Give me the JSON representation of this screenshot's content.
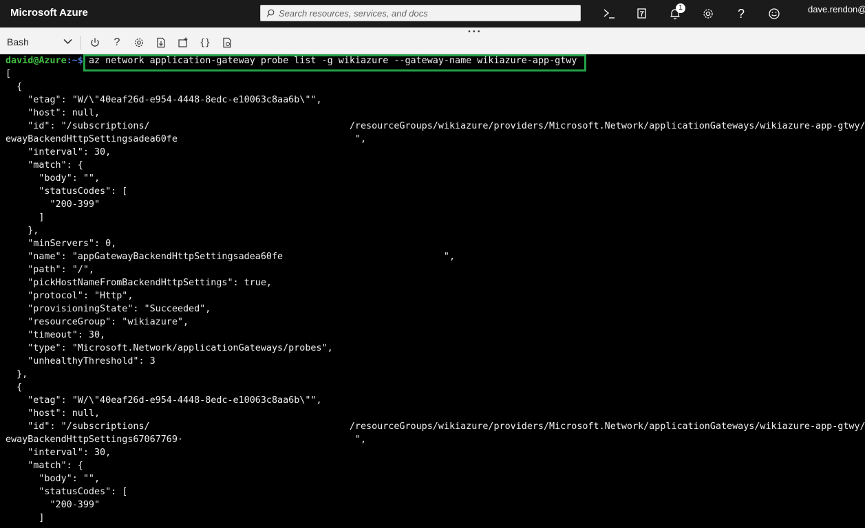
{
  "topbar": {
    "brand": "Microsoft Azure",
    "search_placeholder": "Search resources, services, and docs",
    "notification_count": "1",
    "user": "dave.rendon@",
    "icons": [
      "cloud-shell-icon",
      "directory-filter-icon",
      "bell-icon",
      "gear-icon",
      "help-icon",
      "feedback-smiley-icon"
    ]
  },
  "toolbar": {
    "grip": "•••",
    "shell": "Bash",
    "icons": [
      "power-icon",
      "help-icon",
      "gear-icon",
      "upload-download-icon",
      "new-session-icon",
      "editor-braces-icon",
      "web-preview-icon"
    ]
  },
  "terminal": {
    "prompt_user": "david@Azure",
    "prompt_path": ":~$",
    "command": "az network application-gateway probe list -g wikiazure --gateway-name wikiazure-app-gtwy",
    "highlight_color": "#23a247",
    "output": [
      "[",
      "  {",
      "    \"etag\": \"W/\\\"40eaf26d-e954-4448-8edc-e10063c8aa6b\\\"\",",
      "    \"host\": null,",
      "    \"id\": \"/subscriptions/                                    /resourceGroups/wikiazure/providers/Microsoft.Network/applicationGateways/wikiazure-app-gtwy/p",
      "ewayBackendHttpSettingsadea60fe                                \",",
      "    \"interval\": 30,",
      "    \"match\": {",
      "      \"body\": \"\",",
      "      \"statusCodes\": [",
      "        \"200-399\"",
      "      ]",
      "    },",
      "    \"minServers\": 0,",
      "    \"name\": \"appGatewayBackendHttpSettingsadea60fe                             \",",
      "    \"path\": \"/\",",
      "    \"pickHostNameFromBackendHttpSettings\": true,",
      "    \"protocol\": \"Http\",",
      "    \"provisioningState\": \"Succeeded\",",
      "    \"resourceGroup\": \"wikiazure\",",
      "    \"timeout\": 30,",
      "    \"type\": \"Microsoft.Network/applicationGateways/probes\",",
      "    \"unhealthyThreshold\": 3",
      "  },",
      "  {",
      "    \"etag\": \"W/\\\"40eaf26d-e954-4448-8edc-e10063c8aa6b\\\"\",",
      "    \"host\": null,",
      "    \"id\": \"/subscriptions/                                    /resourceGroups/wikiazure/providers/Microsoft.Network/applicationGateways/wikiazure-app-gtwy/p",
      "ewayBackendHttpSettings67067769·                               \",",
      "    \"interval\": 30,",
      "    \"match\": {",
      "      \"body\": \"\",",
      "      \"statusCodes\": [",
      "        \"200-399\"",
      "      ]"
    ]
  }
}
